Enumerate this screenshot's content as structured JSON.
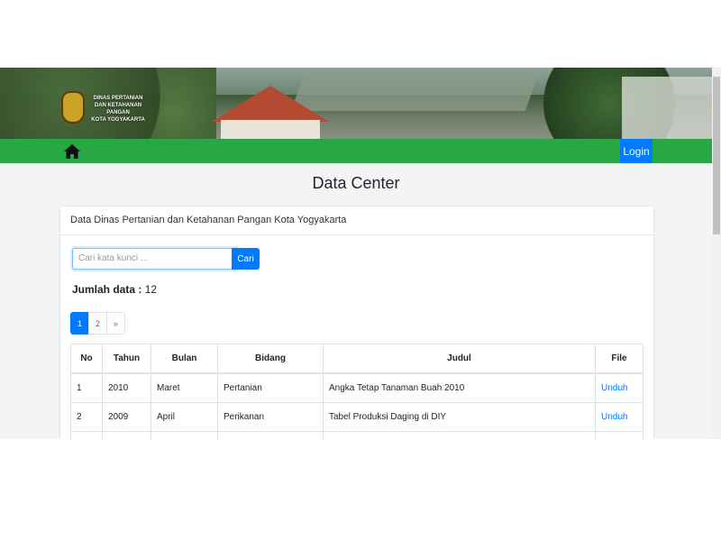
{
  "header": {
    "logo_lines": [
      "DINAS PERTANIAN",
      "DAN KETAHANAN PANGAN",
      "KOTA YOGYAKARTA"
    ],
    "home_icon": "home-icon",
    "login_label": "Login"
  },
  "page": {
    "title": "Data Center"
  },
  "card": {
    "title": "Data Dinas Pertanian dan Ketahanan Pangan Kota Yogyakarta",
    "search": {
      "placeholder": "Cari kata kunci ...",
      "button_label": "Cari"
    },
    "total_label": "Jumlah data :",
    "total_value": "12",
    "pagination": [
      "1",
      "2",
      "»"
    ],
    "table": {
      "headers": [
        "No",
        "Tahun",
        "Bulan",
        "Bidang",
        "Judul",
        "File"
      ],
      "rows": [
        [
          "1",
          "2010",
          "Maret",
          "Pertanian",
          "Angka Tetap Tanaman Buah 2010",
          "Unduh"
        ],
        [
          "2",
          "2009",
          "April",
          "Perikanan",
          "Tabel Produksi Daging di DIY",
          "Unduh"
        ]
      ]
    }
  },
  "colors": {
    "navbar": "#28a745",
    "primary": "#007bff",
    "background": "#f3f4f6"
  }
}
